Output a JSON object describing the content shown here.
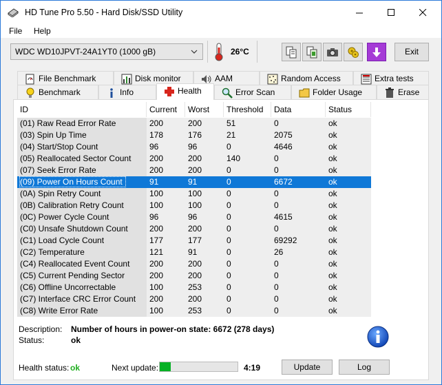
{
  "window": {
    "title": "HD Tune Pro 5.50 - Hard Disk/SSD Utility"
  },
  "menu": {
    "file": "File",
    "help": "Help"
  },
  "toolbar": {
    "drive": "WDC WD10JPVT-24A1YT0 (1000 gB)",
    "temperature": "26°C",
    "exit_label": "Exit"
  },
  "tabs": {
    "row1": [
      "File Benchmark",
      "Disk monitor",
      "AAM",
      "Random Access",
      "Extra tests"
    ],
    "row2": [
      "Benchmark",
      "Info",
      "Health",
      "Error Scan",
      "Folder Usage",
      "Erase"
    ],
    "active": "Health"
  },
  "table": {
    "headers": [
      "ID",
      "Current",
      "Worst",
      "Threshold",
      "Data",
      "Status"
    ],
    "rows": [
      [
        "(01) Raw Read Error Rate",
        "200",
        "200",
        "51",
        "0",
        "ok"
      ],
      [
        "(03) Spin Up Time",
        "178",
        "176",
        "21",
        "2075",
        "ok"
      ],
      [
        "(04) Start/Stop Count",
        "96",
        "96",
        "0",
        "4646",
        "ok"
      ],
      [
        "(05) Reallocated Sector Count",
        "200",
        "200",
        "140",
        "0",
        "ok"
      ],
      [
        "(07) Seek Error Rate",
        "200",
        "200",
        "0",
        "0",
        "ok"
      ],
      [
        "(09) Power On Hours Count",
        "91",
        "91",
        "0",
        "6672",
        "ok"
      ],
      [
        "(0A) Spin Retry Count",
        "100",
        "100",
        "0",
        "0",
        "ok"
      ],
      [
        "(0B) Calibration Retry Count",
        "100",
        "100",
        "0",
        "0",
        "ok"
      ],
      [
        "(0C) Power Cycle Count",
        "96",
        "96",
        "0",
        "4615",
        "ok"
      ],
      [
        "(C0) Unsafe Shutdown Count",
        "200",
        "200",
        "0",
        "0",
        "ok"
      ],
      [
        "(C1) Load Cycle Count",
        "177",
        "177",
        "0",
        "69292",
        "ok"
      ],
      [
        "(C2) Temperature",
        "121",
        "91",
        "0",
        "26",
        "ok"
      ],
      [
        "(C4) Reallocated Event Count",
        "200",
        "200",
        "0",
        "0",
        "ok"
      ],
      [
        "(C5) Current Pending Sector",
        "200",
        "200",
        "0",
        "0",
        "ok"
      ],
      [
        "(C6) Offline Uncorrectable",
        "100",
        "253",
        "0",
        "0",
        "ok"
      ],
      [
        "(C7) Interface CRC Error Count",
        "200",
        "200",
        "0",
        "0",
        "ok"
      ],
      [
        "(C8) Write Error Rate",
        "100",
        "253",
        "0",
        "0",
        "ok"
      ]
    ],
    "selected_index": 5
  },
  "description": {
    "label": "Description:",
    "value": "Number of hours in power-on state: 6672 (278 days)",
    "status_label": "Status:",
    "status_value": "ok"
  },
  "footer": {
    "health_label": "Health status:",
    "health_value": "ok",
    "next_update_label": "Next update:",
    "next_update_progress": 0.14,
    "next_update_time": "4:19",
    "update_button": "Update",
    "log_button": "Log"
  },
  "colors": {
    "selection": "#0f78d7",
    "ok_green": "#1fae1f",
    "progress_green": "#06b025"
  }
}
